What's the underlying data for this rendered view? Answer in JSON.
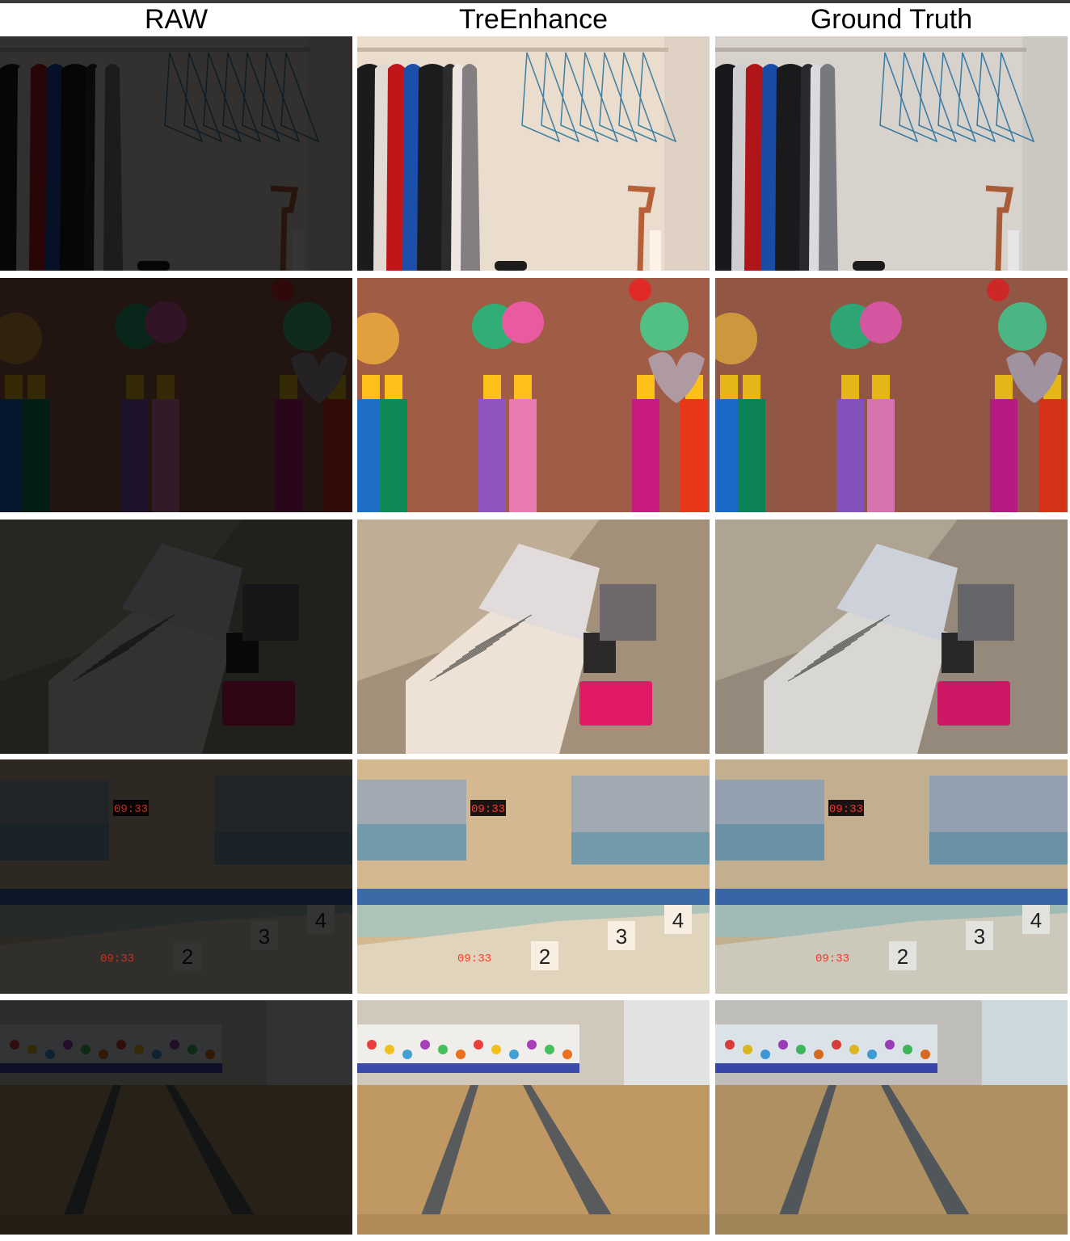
{
  "columns": [
    "RAW",
    "TreEnhance",
    "Ground Truth"
  ],
  "rows": [
    {
      "scene": "wardrobe-with-clothes-and-hangers"
    },
    {
      "scene": "chinese-knot-tassel-ornaments",
      "label": ""
    },
    {
      "scene": "open-book-on-desk"
    },
    {
      "scene": "indoor-swimming-pool",
      "clock_text": "09:33",
      "lane_numbers": [
        "2",
        "3",
        "4"
      ]
    },
    {
      "scene": "bowling-alley"
    }
  ]
}
